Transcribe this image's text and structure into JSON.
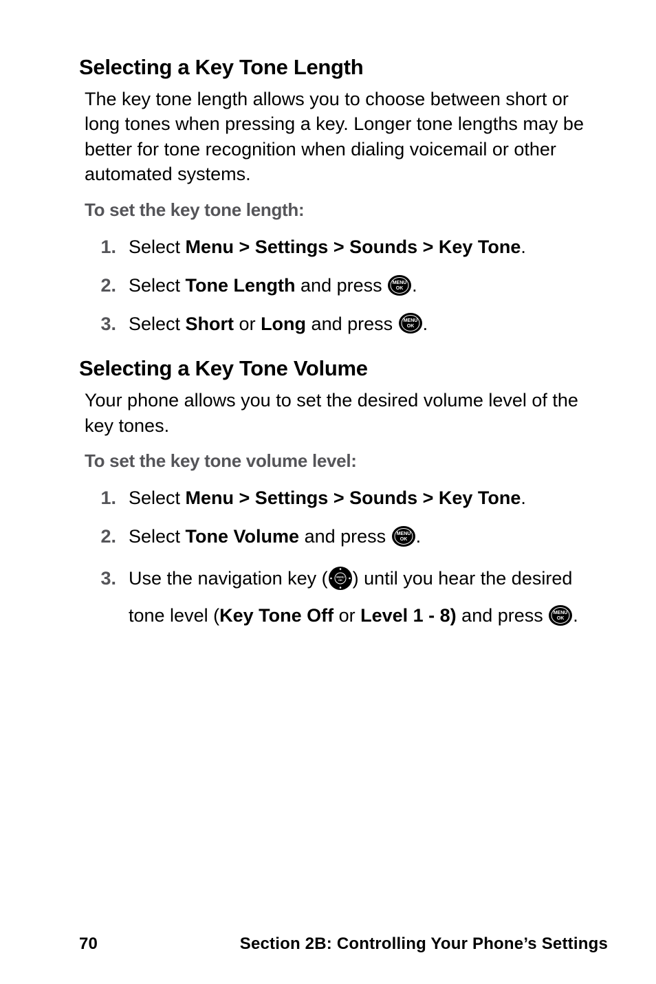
{
  "section1": {
    "heading": "Selecting a Key Tone Length",
    "body": "The key tone length allows you to choose between short or long tones when pressing a key. Longer tone lengths may be better for tone recognition when dialing voicemail or other automated systems.",
    "sub": "To set the key tone length:",
    "steps": {
      "n1": "1.",
      "s1a": "Select ",
      "s1b": "Menu > Settings > Sounds > Key Tone",
      "s1c": ".",
      "n2": "2.",
      "s2a": "Select ",
      "s2b": "Tone Length",
      "s2c": " and press ",
      "s2d": ".",
      "n3": "3.",
      "s3a": "Select ",
      "s3b": "Short",
      "s3c": " or ",
      "s3d": "Long",
      "s3e": " and press ",
      "s3f": "."
    }
  },
  "section2": {
    "heading": "Selecting a Key Tone Volume",
    "body": "Your phone allows you to set the desired volume level of the key tones.",
    "sub": "To set the key tone volume level:",
    "steps": {
      "n1": "1.",
      "s1a": "Select ",
      "s1b": "Menu > Settings > Sounds > Key Tone",
      "s1c": ".",
      "n2": "2.",
      "s2a": "Select ",
      "s2b": "Tone Volume",
      "s2c": " and press ",
      "s2d": ".",
      "n3": "3.",
      "s3a": "Use the navigation key (",
      "s3b": ") until you hear the desired tone level (",
      "s3c": "Key Tone Off",
      "s3d": " or ",
      "s3e": "Level 1 - 8)",
      "s3f": " and press ",
      "s3g": "."
    }
  },
  "footer": {
    "page": "70",
    "section": "Section 2B: Controlling Your Phone’s Settings"
  },
  "icons": {
    "menu_ok": "menu-ok-icon",
    "nav_key": "nav-key-icon"
  }
}
